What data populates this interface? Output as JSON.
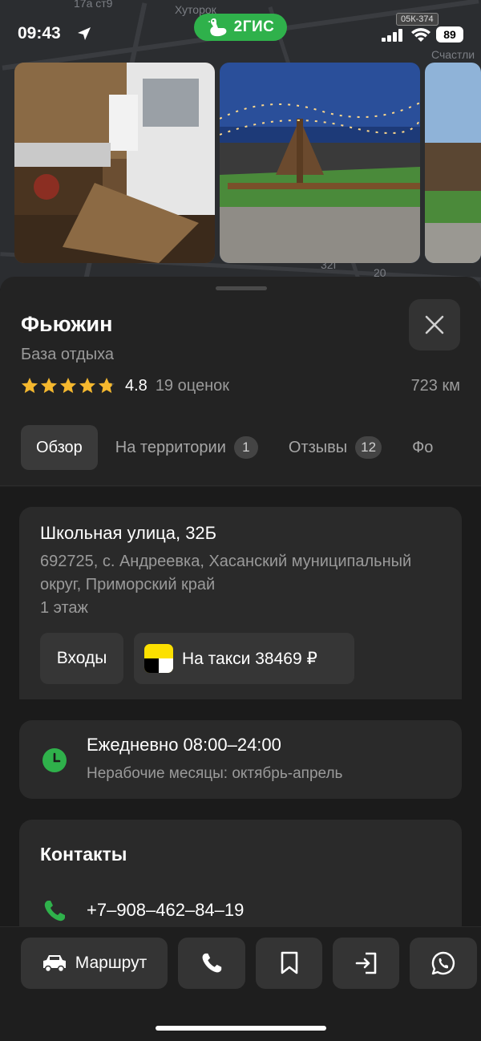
{
  "status_bar": {
    "time": "09:43",
    "battery": "89",
    "brand": "2ГИС",
    "plate": "05К-374"
  },
  "map": {
    "labels": [
      "17а ст9",
      "Хуторок",
      "Счастли",
      "32Г",
      "20"
    ]
  },
  "place": {
    "name": "Фьюжин",
    "category": "База отдыха",
    "rating": "4.8",
    "rating_count": "19 оценок",
    "distance": "723 км",
    "rating_value": 4.8
  },
  "tabs": [
    {
      "label": "Обзор",
      "active": true
    },
    {
      "label": "На территории",
      "count": "1"
    },
    {
      "label": "Отзывы",
      "count": "12"
    },
    {
      "label": "Фо"
    }
  ],
  "address": {
    "street": "Школьная улица, 32Б",
    "full": "692725, с. Андреевка, Хасанский муниципальный округ, Приморский край",
    "floor": "1 этаж",
    "entrances_label": "Входы",
    "taxi_label": "На такси 38469 ₽"
  },
  "hours": {
    "main": "Ежедневно 08:00–24:00",
    "sub": "Нерабочие месяцы: октябрь-апрель"
  },
  "contacts": {
    "title": "Контакты",
    "phone": "+7‒908‒462‒84‒19"
  },
  "actions": {
    "route_label": "Маршрут"
  },
  "colors": {
    "accent_green": "#2fb14b",
    "star": "#f5b82e",
    "sheet": "#232323",
    "card": "#2a2a2a"
  }
}
